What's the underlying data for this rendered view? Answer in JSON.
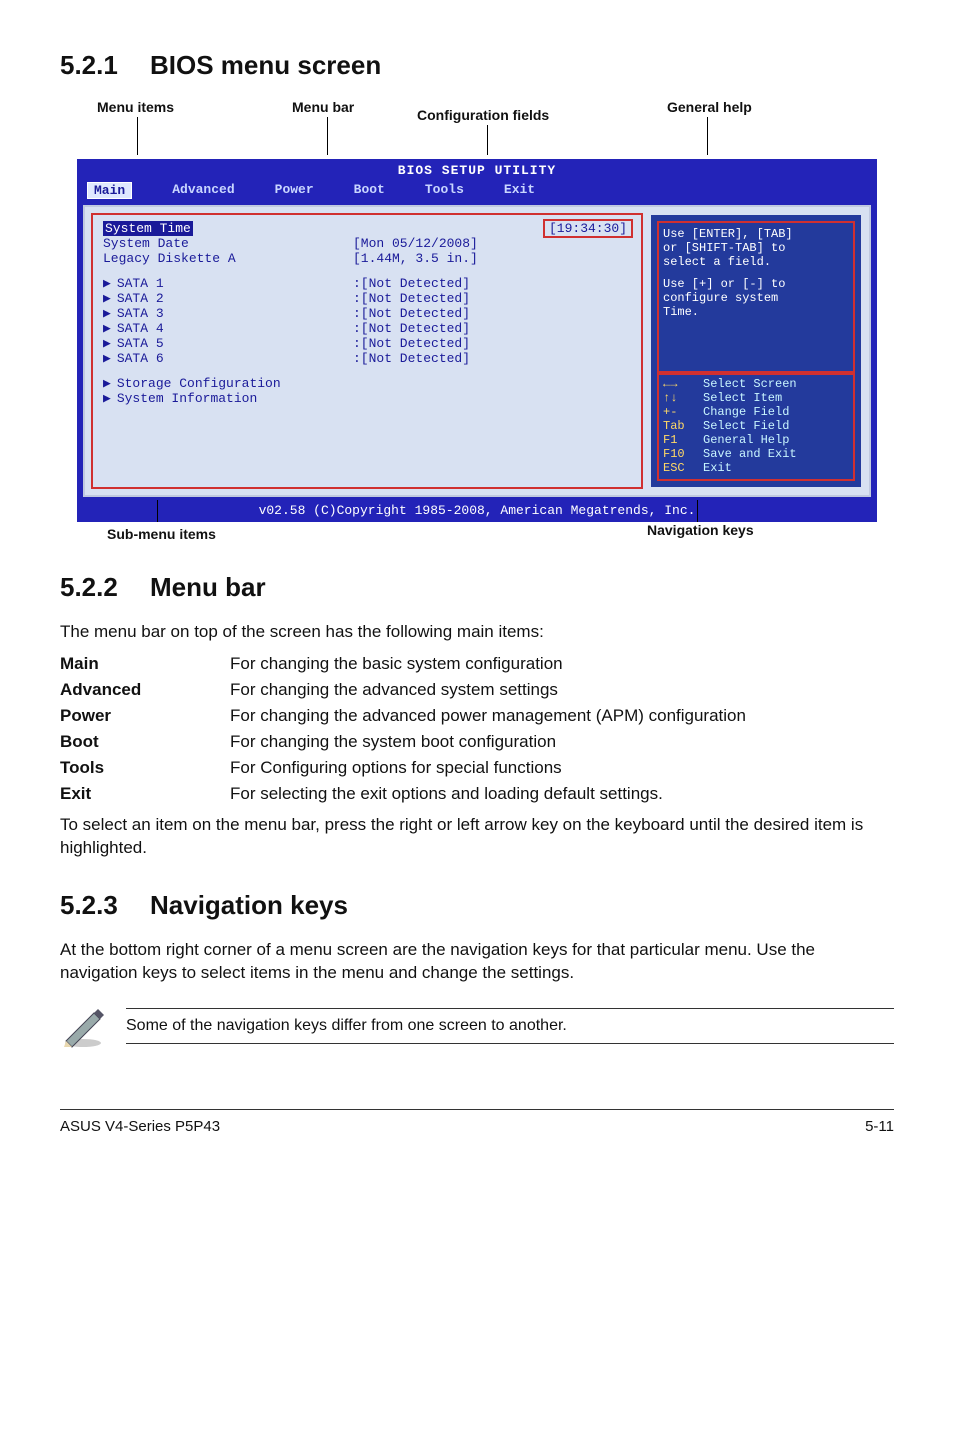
{
  "sec1": {
    "num": "5.2.1",
    "title": "BIOS menu screen"
  },
  "top_labels": {
    "menu_items": "Menu items",
    "menu_bar": "Menu bar",
    "config_fields": "Configuration fields",
    "general_help": "General help"
  },
  "bios": {
    "header": "BIOS SETUP UTILITY",
    "tabs": {
      "main": "Main",
      "advanced": "Advanced",
      "power": "Power",
      "boot": "Boot",
      "tools": "Tools",
      "exit": "Exit"
    },
    "left": {
      "system_time_lbl": "System Time",
      "system_time_val": "[19:34:30]",
      "system_date_lbl": "System Date",
      "system_date_val": "[Mon 05/12/2008]",
      "legacy_lbl": "Legacy Diskette A",
      "legacy_val": "[1.44M, 3.5 in.]",
      "sata1_lbl": "SATA 1",
      "sata1_val": ":[Not Detected]",
      "sata2_lbl": "SATA 2",
      "sata2_val": ":[Not Detected]",
      "sata3_lbl": "SATA 3",
      "sata3_val": ":[Not Detected]",
      "sata4_lbl": "SATA 4",
      "sata4_val": ":[Not Detected]",
      "sata5_lbl": "SATA 5",
      "sata5_val": ":[Not Detected]",
      "sata6_lbl": "SATA 6",
      "sata6_val": ":[Not Detected]",
      "storage_lbl": "Storage Configuration",
      "sysinfo_lbl": "System Information"
    },
    "help": {
      "l1": "Use [ENTER], [TAB]",
      "l2": "or [SHIFT-TAB] to",
      "l3": "select a field.",
      "l4": "Use [+] or [-] to",
      "l5": "configure system",
      "l6": "Time."
    },
    "nav": {
      "lr_k": "←→",
      "lr_d": "Select Screen",
      "ud_k": "↑↓",
      "ud_d": "Select Item",
      "pm_k": "+-",
      "pm_d": "Change Field",
      "tab_k": "Tab",
      "tab_d": "Select Field",
      "f1_k": "F1",
      "f1_d": "General Help",
      "f10_k": "F10",
      "f10_d": "Save and Exit",
      "esc_k": "ESC",
      "esc_d": "Exit"
    },
    "footer": "v02.58 (C)Copyright 1985-2008, American Megatrends, Inc."
  },
  "bottom_labels": {
    "sub_menu": "Sub-menu items",
    "nav_keys": "Navigation keys"
  },
  "sec2": {
    "num": "5.2.2",
    "title": "Menu bar"
  },
  "sec2_intro": "The menu bar on top of the screen has the following main items:",
  "defs": {
    "main_t": "Main",
    "main_d": "For changing the basic system configuration",
    "adv_t": "Advanced",
    "adv_d": "For changing the advanced system settings",
    "pow_t": "Power",
    "pow_d": "For changing the advanced power management (APM) configuration",
    "boot_t": "Boot",
    "boot_d": "For changing the system boot configuration",
    "tools_t": "Tools",
    "tools_d": "For Configuring options for special functions",
    "exit_t": "Exit",
    "exit_d": "For selecting the exit options and loading default settings."
  },
  "sec2_outro": "To select an item on the menu bar, press the right or left arrow key on the keyboard until the desired item is highlighted.",
  "sec3": {
    "num": "5.2.3",
    "title": "Navigation keys"
  },
  "sec3_body": "At the bottom right corner of a menu screen are the navigation keys for that particular menu. Use the navigation keys to select items in the menu and change the settings.",
  "note": "Some of the navigation keys differ from one screen to another.",
  "footer": {
    "left": "ASUS V4-Series P5P43",
    "right": "5-11"
  }
}
